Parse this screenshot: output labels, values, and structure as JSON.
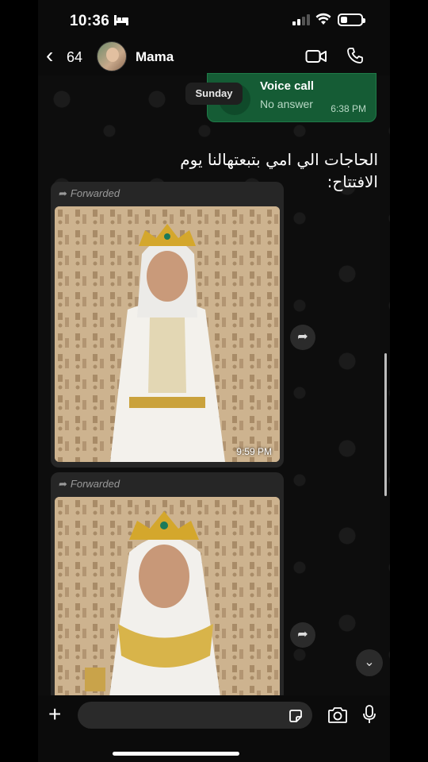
{
  "status_bar": {
    "time": "10:36"
  },
  "header": {
    "back_count": "64",
    "contact_name": "Mama"
  },
  "voice_call": {
    "title": "Voice call",
    "subtitle": "No answer",
    "time": "6:38 PM"
  },
  "day_separator": "Sunday",
  "overlay_text": "الحاجات الي امي بتبعتهالنا يوم الافتتاح:",
  "messages": [
    {
      "forwarded_label": "Forwarded",
      "time": "9:59 PM"
    },
    {
      "forwarded_label": "Forwarded",
      "time": ""
    }
  ],
  "icons": [
    "chevron-left-icon",
    "video-call-icon",
    "phone-icon",
    "forward-arrow-icon",
    "share-icon",
    "chevron-down-icon",
    "plus-icon",
    "sticker-icon",
    "camera-icon",
    "microphone-icon"
  ],
  "colors": {
    "outgoing_bubble": "#155c35",
    "background": "#0b0b0b",
    "incoming_bubble": "#262626"
  }
}
